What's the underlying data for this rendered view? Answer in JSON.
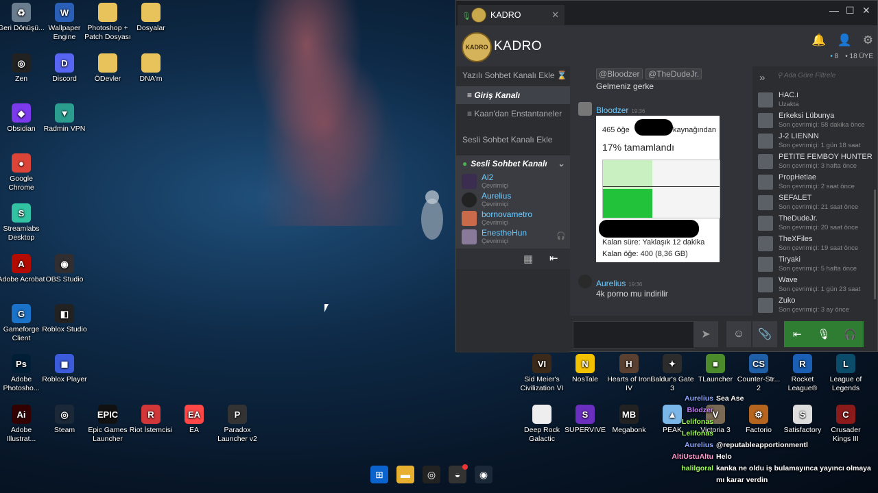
{
  "desktop_icons": [
    {
      "label": "Geri Dönüşü...",
      "icon": "recycle-bin-icon",
      "color": "#6a7d8f",
      "glyph": "♻"
    },
    {
      "label": "Wallpaper Engine",
      "icon": "wallpaper-engine-icon",
      "color": "#2a5fb8",
      "glyph": "W"
    },
    {
      "label": "Photoshop + Patch Dosyası",
      "icon": "folder-icon",
      "color": "#e8c25a",
      "glyph": ""
    },
    {
      "label": "Dosyalar",
      "icon": "folder-icon",
      "color": "#e8c25a",
      "glyph": ""
    },
    {
      "label": "Zen",
      "icon": "zen-icon",
      "color": "#222",
      "glyph": "◎"
    },
    {
      "label": "Discord",
      "icon": "discord-icon",
      "color": "#5865f2",
      "glyph": "D"
    },
    {
      "label": "ÖDevler",
      "icon": "folder-icon",
      "color": "#e8c25a",
      "glyph": ""
    },
    {
      "label": "DNA'm",
      "icon": "folder-icon",
      "color": "#e8c25a",
      "glyph": ""
    },
    {
      "label": "Obsidian",
      "icon": "obsidian-icon",
      "color": "#7c3aed",
      "glyph": "◆"
    },
    {
      "label": "Radmin VPN",
      "icon": "radmin-vpn-icon",
      "color": "#2a9d8f",
      "glyph": "▼"
    },
    {
      "label": "Google Chrome",
      "icon": "chrome-icon",
      "color": "#db4437",
      "glyph": "●"
    },
    {
      "label": "Streamlabs Desktop",
      "icon": "streamlabs-icon",
      "color": "#31c3a2",
      "glyph": "S"
    },
    {
      "label": "Adobe Acrobat",
      "icon": "acrobat-icon",
      "color": "#b30b00",
      "glyph": "A"
    },
    {
      "label": "OBS Studio",
      "icon": "obs-icon",
      "color": "#302e31",
      "glyph": "◉"
    },
    {
      "label": "Gameforge Client",
      "icon": "gameforge-icon",
      "color": "#1a73c8",
      "glyph": "G"
    },
    {
      "label": "Roblox Studio",
      "icon": "roblox-studio-icon",
      "color": "#222",
      "glyph": "◧"
    },
    {
      "label": "Adobe Photosho...",
      "icon": "photoshop-icon",
      "color": "#001e36",
      "glyph": "Ps"
    },
    {
      "label": "Roblox Player",
      "icon": "roblox-icon",
      "color": "#3b5bdb",
      "glyph": "◼"
    },
    {
      "label": "Adobe Illustrat...",
      "icon": "illustrator-icon",
      "color": "#330000",
      "glyph": "Ai"
    },
    {
      "label": "Steam",
      "icon": "steam-icon",
      "color": "#1b2838",
      "glyph": "◎"
    },
    {
      "label": "Epic Games Launcher",
      "icon": "epic-games-icon",
      "color": "#111",
      "glyph": "EPIC"
    },
    {
      "label": "Riot İstemcisi",
      "icon": "riot-icon",
      "color": "#d13639",
      "glyph": "R"
    },
    {
      "label": "EA",
      "icon": "ea-icon",
      "color": "#ff4747",
      "glyph": "EA"
    },
    {
      "label": "Paradox Launcher v2",
      "icon": "paradox-icon",
      "color": "#333",
      "glyph": "P"
    },
    {
      "label": "Sid Meier's Civilization VI",
      "icon": "civ6-icon",
      "color": "#3b2a1a",
      "glyph": "VI"
    },
    {
      "label": "NosTale",
      "icon": "nostale-icon",
      "color": "#f2c200",
      "glyph": "N"
    },
    {
      "label": "Hearts of Iron IV",
      "icon": "hoi4-icon",
      "color": "#5a4030",
      "glyph": "H"
    },
    {
      "label": "Baldur's Gate 3",
      "icon": "bg3-icon",
      "color": "#2c2c2c",
      "glyph": "✦"
    },
    {
      "label": "TLauncher",
      "icon": "tlauncher-icon",
      "color": "#4c8b2b",
      "glyph": "■"
    },
    {
      "label": "Counter-Str... 2",
      "icon": "cs2-icon",
      "color": "#1f5fa8",
      "glyph": "CS"
    },
    {
      "label": "Rocket League®",
      "icon": "rocket-league-icon",
      "color": "#1a5fb4",
      "glyph": "R"
    },
    {
      "label": "League of Legends",
      "icon": "lol-icon",
      "color": "#0a4c6a",
      "glyph": "L"
    },
    {
      "label": "Deep Rock Galactic",
      "icon": "drg-icon",
      "color": "#eee",
      "glyph": ""
    },
    {
      "label": "SUPERVIVE",
      "icon": "supervive-icon",
      "color": "#6b2fbf",
      "glyph": "S"
    },
    {
      "label": "Megabonk",
      "icon": "megabonk-icon",
      "color": "#222",
      "glyph": "MB"
    },
    {
      "label": "PEAK",
      "icon": "peak-icon",
      "color": "#7ab6e8",
      "glyph": "▲"
    },
    {
      "label": "Victoria 3",
      "icon": "victoria3-icon",
      "color": "#7a6a55",
      "glyph": "V"
    },
    {
      "label": "Factorio",
      "icon": "factorio-icon",
      "color": "#b5651d",
      "glyph": "⚙"
    },
    {
      "label": "Satisfactory",
      "icon": "satisfactory-icon",
      "color": "#ddd",
      "glyph": "S"
    },
    {
      "label": "Crusader Kings III",
      "icon": "ck3-icon",
      "color": "#8b1a1a",
      "glyph": "C"
    }
  ],
  "chat_window": {
    "tab_title": "KADRO",
    "group_name": "KADRO",
    "logo_text": "KADRO",
    "online_count": "8",
    "members_count": "18 ÜYE",
    "left": {
      "add_text_channel": "Yazılı Sohbet Kanalı Ekle",
      "channels": [
        "Giriş Kanalı",
        "Kaan'dan Enstantaneler"
      ],
      "add_voice_channel": "Sesli Sohbet Kanalı Ekle",
      "voice_channel_name": "Sesli Sohbet Kanalı",
      "voice_members": [
        {
          "name": "Al2",
          "status": "Çevrimiçi"
        },
        {
          "name": "Aurelius",
          "status": "Çevrimiçi"
        },
        {
          "name": "bornovametro",
          "status": "Çevrimiçi"
        },
        {
          "name": "EnestheHun",
          "status": "Çevrimiçi"
        }
      ]
    },
    "messages": {
      "mention1": "@Bloodzer",
      "mention2": "@TheDudeJr.",
      "text1": "Gelmeniz gerke",
      "author2": "Bloodzer",
      "time2": "19:36",
      "shot_line1_a": "465 öğe",
      "shot_line1_b": "kaynağından",
      "shot_progress": "17%  tamamlandı",
      "shot_progress_value": 0.17,
      "shot_remaining_time": "Kalan süre: Yaklaşık 12 dakika",
      "shot_remaining_items": "Kalan öğe: 400 (8,36 GB)",
      "author3": "Aurelius",
      "time3": "19:36",
      "text3": "4k porno mu indirilir"
    },
    "members_filter_placeholder": "Ada Göre Filtrele",
    "members": [
      {
        "name": "HAC.i",
        "status": "Uzakta"
      },
      {
        "name": "Erkeksi Lübunya",
        "status": "Son çevrimiçi: 58 dakika önce"
      },
      {
        "name": "J-2 LIENNN",
        "status": "Son çevrimiçi: 1 gün 18 saat"
      },
      {
        "name": "PETITE FEMBOY HUNTER",
        "status": "Son çevrimiçi: 3 hafta önce"
      },
      {
        "name": "PropHetiae",
        "status": "Son çevrimiçi: 2 saat önce"
      },
      {
        "name": "SEFALET",
        "status": "Son çevrimiçi: 21 saat önce"
      },
      {
        "name": "TheDudeJr.",
        "status": "Son çevrimiçi: 20 saat önce"
      },
      {
        "name": "TheXFiles",
        "status": "Son çevrimiçi: 19 saat önce"
      },
      {
        "name": "Tiryaki",
        "status": "Son çevrimiçi: 5 hafta önce"
      },
      {
        "name": "Wave",
        "status": "Son çevrimiçi: 1 gün 23 saat"
      },
      {
        "name": "Zuko",
        "status": "Son çevrimiçi: 3 ay önce"
      }
    ]
  },
  "overlay_chat": [
    {
      "user": "Aurelius",
      "color": "#8fa8ff",
      "msg": "Sea Ase"
    },
    {
      "user": "Blodzer",
      "color": "#c77dff",
      "msg": ""
    },
    {
      "user": "Lelifonas",
      "color": "#9cff57",
      "msg": ""
    },
    {
      "user": "Lelifonas",
      "color": "#9cff57",
      "msg": ""
    },
    {
      "user": "Aurelius",
      "color": "#8fa8ff",
      "msg": "@reputableapportionmentl"
    },
    {
      "user": "AltiUstuAltu",
      "color": "#ff9ecf",
      "msg": "Helo"
    },
    {
      "user": "halilgoral",
      "color": "#9cff57",
      "msg": "kanka ne oldu iş bulamayınca yayıncı olmaya"
    },
    {
      "user": "",
      "color": "#fff",
      "msg": "mı karar verdin"
    }
  ]
}
